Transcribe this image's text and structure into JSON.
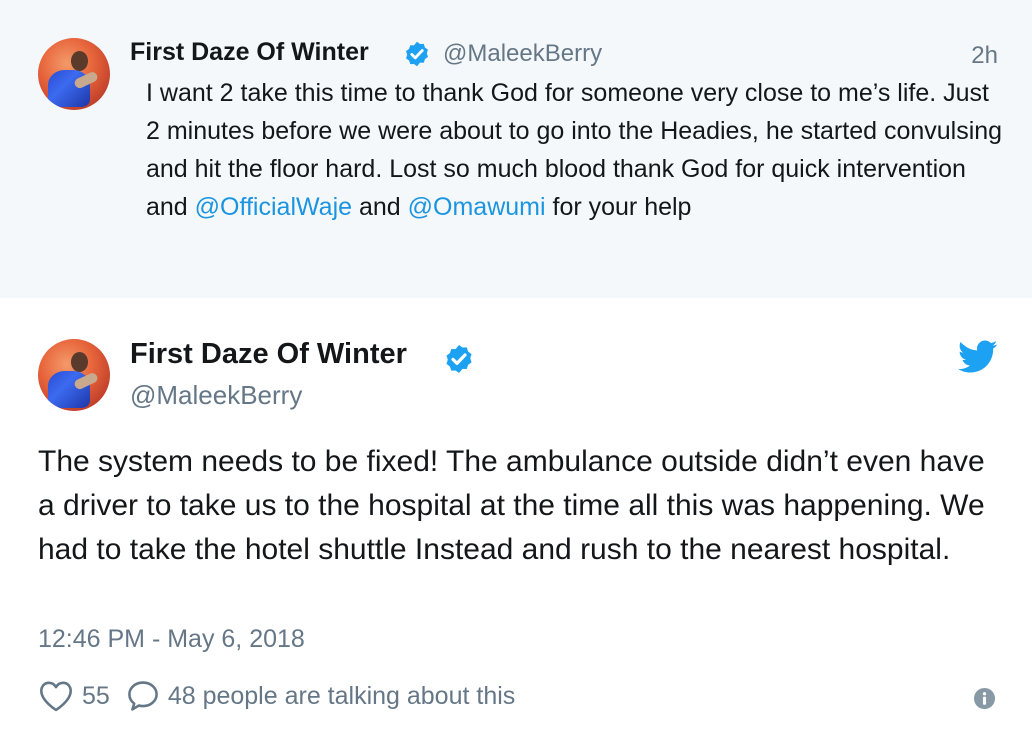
{
  "parent_tweet": {
    "display_name": "First Daze Of Winter",
    "handle": "@MaleekBerry",
    "time": "2h",
    "text_parts": [
      "I want 2 take this time to thank God for someone very close to me’s life. Just 2 minutes before we were about to go into the Headies, he started convulsing and hit the floor hard. Lost so much blood thank God for quick intervention and ",
      "@OfficialWaje",
      " and ",
      "@Omawumi",
      " for your help"
    ]
  },
  "main_tweet": {
    "display_name": "First Daze Of Winter",
    "handle": "@MaleekBerry",
    "text": "The system needs to be fixed! The ambulance outside didn’t even have a driver to take us to the hospital at the time all this was happening. We had to take the hotel shuttle Instead and rush to the nearest hospital.",
    "datetime": "12:46 PM - May 6, 2018",
    "likes": "55",
    "talking": "48 people are talking about this"
  },
  "icons": {
    "verified": "verified-badge-icon",
    "brand": "twitter-bird-icon",
    "like": "heart-icon",
    "reply": "speech-bubble-icon",
    "info": "info-icon"
  },
  "colors": {
    "link": "#1b95e0",
    "verified": "#1da1f2",
    "muted": "#657786",
    "parent_bg": "#f5f8fa"
  }
}
